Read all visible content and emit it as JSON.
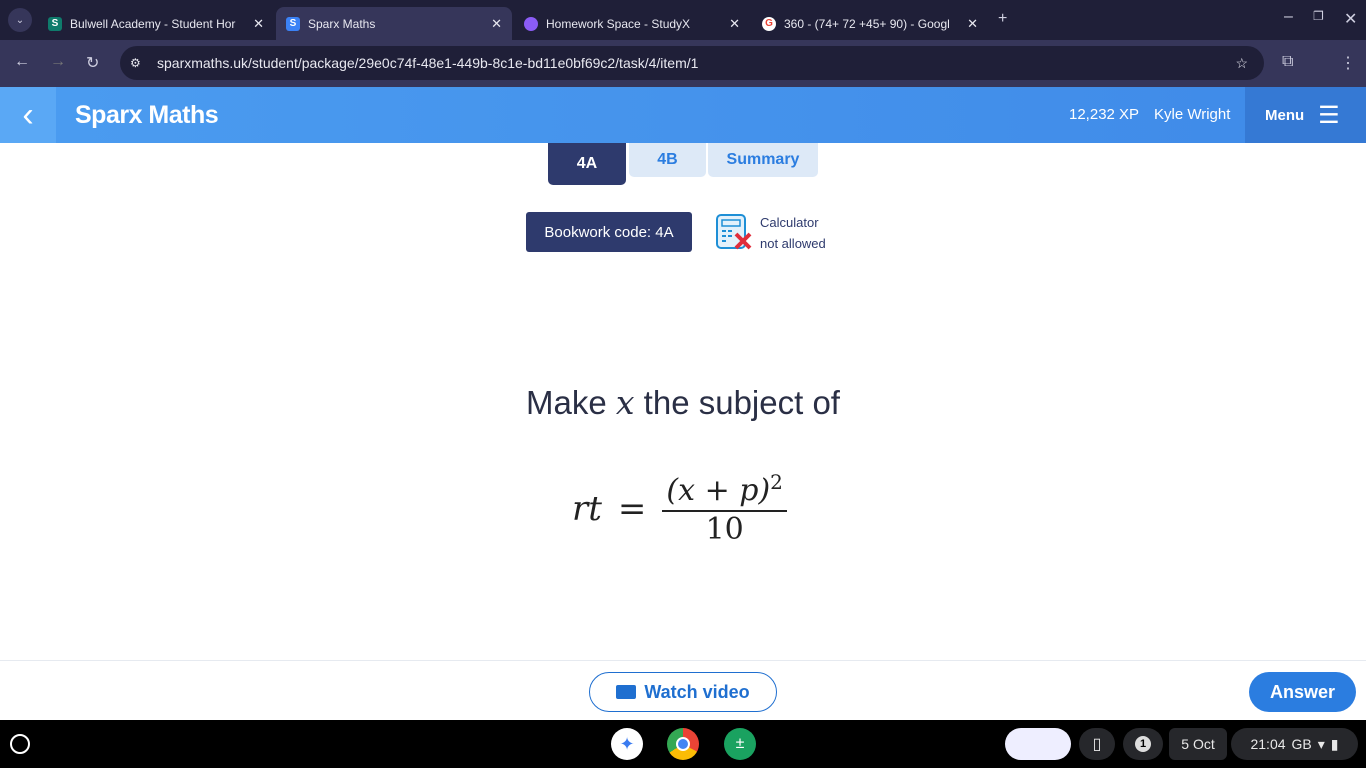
{
  "browser": {
    "tabs": [
      {
        "title": "Bulwell Academy - Student Hor",
        "favicon_color": "#0f7b6c"
      },
      {
        "title": "Sparx Maths",
        "favicon_color": "#3b82f6",
        "active": true
      },
      {
        "title": "Homework Space - StudyX",
        "favicon_color": "#8b5cf6"
      },
      {
        "title": "360 - (74+ 72 +45+ 90) - Googl",
        "favicon_color": "#ea4335"
      }
    ],
    "url": "sparxmaths.uk/student/package/29e0c74f-48e1-449b-8c1e-bd11e0bf69c2/task/4/item/1"
  },
  "header": {
    "brand": "Sparx Maths",
    "xp": "12,232 XP",
    "user": "Kyle Wright",
    "menu": "Menu"
  },
  "tabs": [
    {
      "label": "4A",
      "active": true
    },
    {
      "label": "4B"
    },
    {
      "label": "Summary"
    }
  ],
  "bookwork": "Bookwork code: 4A",
  "calculator": {
    "line1": "Calculator",
    "line2": "not allowed"
  },
  "question": {
    "prefix": "Make ",
    "var": "x",
    "suffix": " the subject of",
    "lhs": "rt",
    "eq": "=",
    "numerator": "(x + p)",
    "exponent": "2",
    "denominator": "10"
  },
  "footer": {
    "watch": "Watch video",
    "answer": "Answer"
  },
  "shelf": {
    "notifications": "1",
    "date": "5 Oct",
    "time": "21:04",
    "locale": "GB"
  }
}
